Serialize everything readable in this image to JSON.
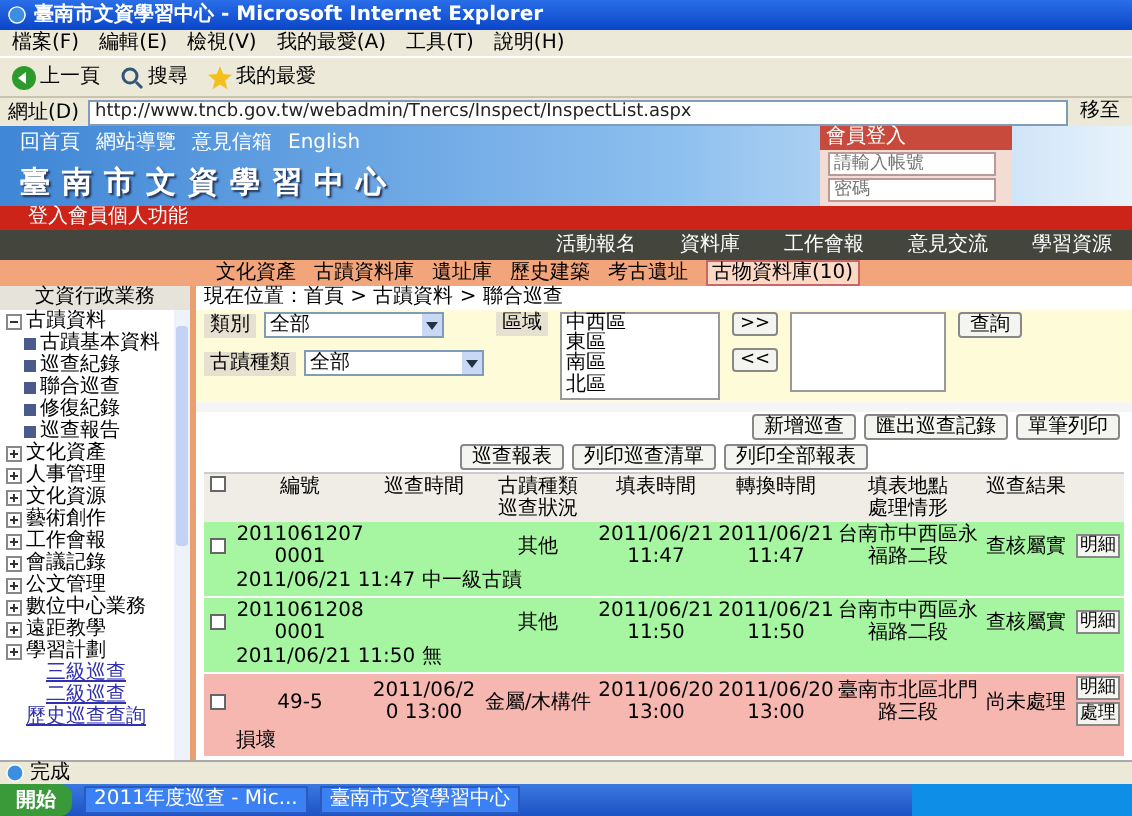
{
  "window": {
    "title": "臺南市文資學習中心 - Microsoft Internet Explorer"
  },
  "menu": [
    "檔案(F)",
    "編輯(E)",
    "檢視(V)",
    "我的最愛(A)",
    "工具(T)",
    "說明(H)"
  ],
  "toolbar": {
    "back": "上一頁",
    "search": "搜尋",
    "favorites": "我的最愛"
  },
  "address": {
    "label": "網址(D)",
    "url": "http://www.tncb.gov.tw/webadmin/Tnercs/Inspect/InspectList.aspx",
    "go": "移至"
  },
  "banner": {
    "links": [
      "回首頁",
      "網站導覽",
      "意見信箱",
      "English"
    ],
    "title": "臺南市文資學習中心",
    "login": {
      "title": "會員登入",
      "account_placeholder": "請輸入帳號",
      "password_placeholder": "密碼"
    }
  },
  "user_bar": "登入會員個人功能",
  "nav": [
    "活動報名",
    "資料庫",
    "工作會報",
    "意見交流",
    "學習資源"
  ],
  "subnav": [
    {
      "label": "文化資產",
      "selected": false
    },
    {
      "label": "古蹟資料庫",
      "selected": false
    },
    {
      "label": "遺址庫",
      "selected": false
    },
    {
      "label": "歷史建築",
      "selected": false
    },
    {
      "label": "考古遺址",
      "selected": false
    },
    {
      "label": "古物資料庫(10)",
      "selected": true
    }
  ],
  "sidebar": {
    "title": "文資行政業務",
    "tree": [
      {
        "label": "古蹟資料",
        "expanded": true,
        "children": [
          {
            "label": "古蹟基本資料"
          },
          {
            "label": "巡查紀錄"
          },
          {
            "label": "聯合巡查"
          },
          {
            "label": "修復紀錄"
          },
          {
            "label": "巡查報告"
          }
        ]
      },
      {
        "label": "文化資產",
        "expanded": false
      },
      {
        "label": "人事管理",
        "expanded": false
      },
      {
        "label": "文化資源",
        "expanded": false
      },
      {
        "label": "藝術創作",
        "expanded": false
      },
      {
        "label": "工作會報",
        "expanded": false
      },
      {
        "label": "會議記錄",
        "expanded": false
      },
      {
        "label": "公文管理",
        "expanded": false
      },
      {
        "label": "數位中心業務",
        "expanded": false
      },
      {
        "label": "遠距教學",
        "expanded": false
      },
      {
        "label": "學習計劃",
        "expanded": false
      }
    ],
    "links": [
      "三級巡查",
      "二級巡查",
      "歷史巡查查詢"
    ]
  },
  "breadcrumb": "現在位置：首頁 > 古蹟資料 > 聯合巡查",
  "filter": {
    "category_label": "類別",
    "category_value": "全部",
    "kind_label": "古蹟種類",
    "kind_value": "全部",
    "area_label": "區域",
    "areas": [
      "中西區",
      "東區",
      "南區",
      "北區"
    ],
    "add": ">>",
    "remove": "<<",
    "query": "查詢"
  },
  "actions_top": [
    "新增巡查",
    "匯出巡查記錄",
    "單筆列印"
  ],
  "actions_bottom": [
    "巡查報表",
    "列印巡查清單",
    "列印全部報表"
  ],
  "table": {
    "select_all": {
      "checked": false
    },
    "columns": [
      "編號",
      "巡查時間",
      "古蹟種類",
      "填表時間",
      "轉換時間",
      "填表地點",
      "巡查結果"
    ],
    "subcolumns": [
      "巡查狀況",
      "處理情形"
    ],
    "rows": [
      {
        "color": "#a6f5a0",
        "checked": false,
        "id": "20110612070001",
        "kind": "其他",
        "filled": "2011/06/21 11:47",
        "converted": "2011/06/21 11:47",
        "place": "台南市中西區永福路二段",
        "result": "查核屬實",
        "note": "2011/06/21 11:47 中一級古蹟",
        "buttons": [
          "明細"
        ]
      },
      {
        "color": "#a6f5a0",
        "checked": false,
        "id": "20110612080001",
        "kind": "其他",
        "filled": "2011/06/21 11:50",
        "converted": "2011/06/21 11:50",
        "place": "台南市中西區永福路二段",
        "result": "查核屬實",
        "note": "2011/06/21 11:50 無",
        "buttons": [
          "明細"
        ]
      },
      {
        "color": "#f5b7b0",
        "checked": false,
        "id": "49-5",
        "time": "2011/06/20 13:00",
        "kind": "金屬/木構件",
        "filled": "2011/06/20 13:00",
        "converted": "2011/06/20 13:00",
        "place": "臺南市北區北門路三段",
        "result": "尚未處理",
        "note": "損壞",
        "buttons": [
          "明細",
          "處理"
        ]
      }
    ]
  },
  "status_bar": "完成",
  "taskbar": {
    "start": "開始",
    "tasks": [
      "2011年度巡查 - Mic...",
      "臺南市文資學習中心"
    ]
  }
}
